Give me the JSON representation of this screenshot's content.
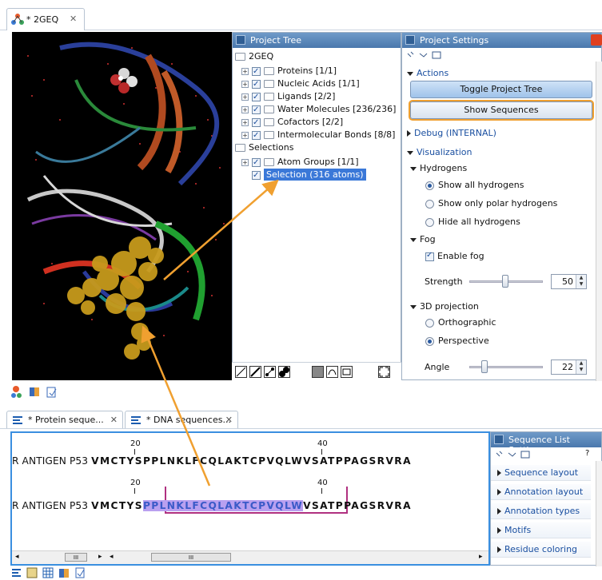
{
  "top_tab": {
    "label": "* 2GEQ",
    "close": "✕"
  },
  "project_tree": {
    "title": "Project Tree",
    "root": "2GEQ",
    "items": [
      {
        "expander": "+",
        "label": "Proteins [1/1]"
      },
      {
        "expander": "+",
        "label": "Nucleic Acids [1/1]"
      },
      {
        "expander": "+",
        "label": "Ligands [2/2]"
      },
      {
        "expander": "+",
        "label": "Water Molecules [236/236]"
      },
      {
        "expander": "+",
        "label": "Cofactors [2/2]"
      },
      {
        "expander": "+",
        "label": "Intermolecular Bonds [8/8]"
      }
    ],
    "selections_root": "Selections",
    "selection_items": [
      {
        "expander": "+",
        "label": "Atom Groups [1/1]"
      },
      {
        "label": "Selection (316 atoms)"
      }
    ]
  },
  "project_settings": {
    "title": "Project Settings",
    "actions_label": "Actions",
    "toggle_tree_label": "Toggle Project Tree",
    "show_sequences_label": "Show Sequences",
    "debug_label": "Debug (INTERNAL)",
    "visualization_label": "Visualization",
    "hydrogens_label": "Hydrogens",
    "hydrogen_options": [
      "Show all hydrogens",
      "Show only polar hydrogens",
      "Hide all hydrogens"
    ],
    "hydrogen_selected": 0,
    "fog_label": "Fog",
    "enable_fog_label": "Enable fog",
    "fog_enabled": true,
    "strength_label": "Strength",
    "strength_value": "50",
    "projection_label": "3D projection",
    "projection_options": [
      "Orthographic",
      "Perspective"
    ],
    "projection_selected": 1,
    "angle_label": "Angle",
    "angle_value": "22"
  },
  "bottom_tabs": [
    {
      "label": "* Protein seque...",
      "close": "✕"
    },
    {
      "label": "* DNA sequences...",
      "close": "✕"
    }
  ],
  "sequence_view": {
    "ruler_1": [
      "20",
      "40"
    ],
    "ruler_2": [
      "20",
      "40"
    ],
    "row1": {
      "name": "R ANTIGEN P53",
      "seq": "VMCTYSPPLNKLFCQLAKTCPVQLWVSATPPAGSRVRA"
    },
    "row2": {
      "name": "R ANTIGEN P53",
      "seq_before": "VMCTYS",
      "seq_selected": "PPLNKLFCQLAKTCPVQLW",
      "seq_after": "VSATPPAGSRVRA"
    },
    "scroll_label": "III"
  },
  "seq_list_settings": {
    "title": "Sequence List Setti...",
    "help": "?",
    "items": [
      "Sequence layout",
      "Annotation layout",
      "Annotation types",
      "Motifs",
      "Residue coloring"
    ]
  },
  "colors": {
    "accent_blue": "#3a8fe0",
    "highlight_orange": "#f0a030",
    "selection_purple": "#a070e0",
    "panel_title": "#4a78ad"
  }
}
